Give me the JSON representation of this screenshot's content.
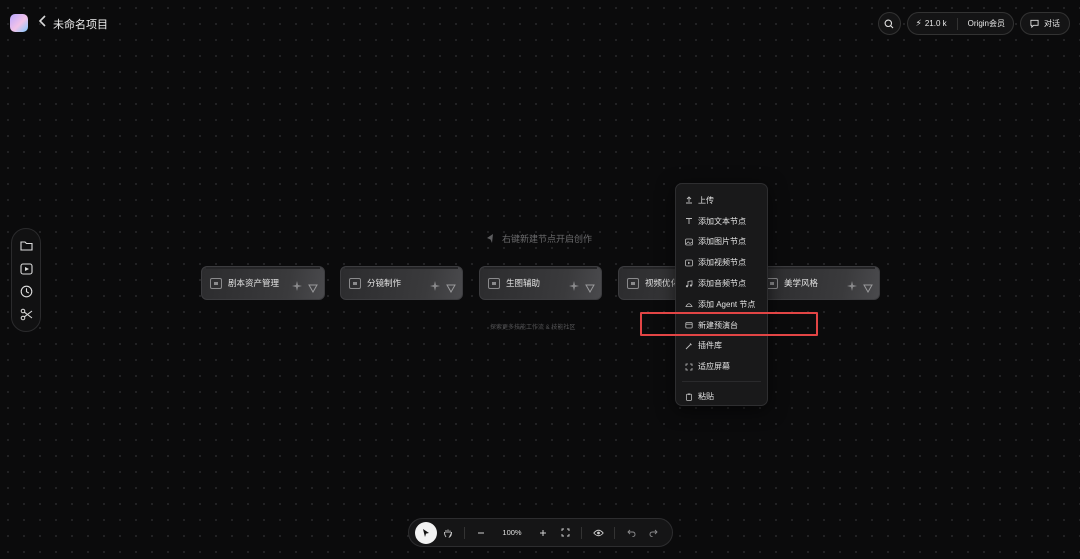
{
  "header": {
    "back_icon": "chevron-left-icon",
    "title": "未命名项目",
    "credits": "21.0 k",
    "membership": "Origin会员",
    "chat_label": "对话"
  },
  "left_rail": [
    "folder-icon",
    "media-icon",
    "history-icon",
    "scissors-icon"
  ],
  "canvas": {
    "hint": "右键新建节点开启创作",
    "sub_hint": "探索更多技能工作流 & 技能社区"
  },
  "cards": [
    {
      "label": "剧本资产管理"
    },
    {
      "label": "分镜制作"
    },
    {
      "label": "生图辅助"
    },
    {
      "label": "视频优化"
    },
    {
      "label": "美学风格"
    }
  ],
  "context_menu": {
    "items": [
      {
        "label": "上传",
        "icon": "upload-icon"
      },
      {
        "label": "添加文本节点",
        "icon": "text-icon"
      },
      {
        "label": "添加图片节点",
        "icon": "image-icon"
      },
      {
        "label": "添加视频节点",
        "icon": "video-icon"
      },
      {
        "label": "添加音频节点",
        "icon": "audio-icon"
      },
      {
        "label": "添加 Agent 节点",
        "icon": "agent-icon"
      },
      {
        "label": "新建预演台",
        "icon": "stage-icon"
      },
      {
        "label": "插件库",
        "icon": "plugin-icon"
      },
      {
        "label": "适应屏幕",
        "icon": "fit-icon"
      },
      {
        "label": "粘贴",
        "icon": "paste-icon"
      }
    ],
    "highlighted": "新建预演台"
  },
  "toolbar": {
    "zoom": "100%"
  },
  "colors": {
    "background": "#0b0b0c",
    "highlight_border": "#e24545"
  }
}
